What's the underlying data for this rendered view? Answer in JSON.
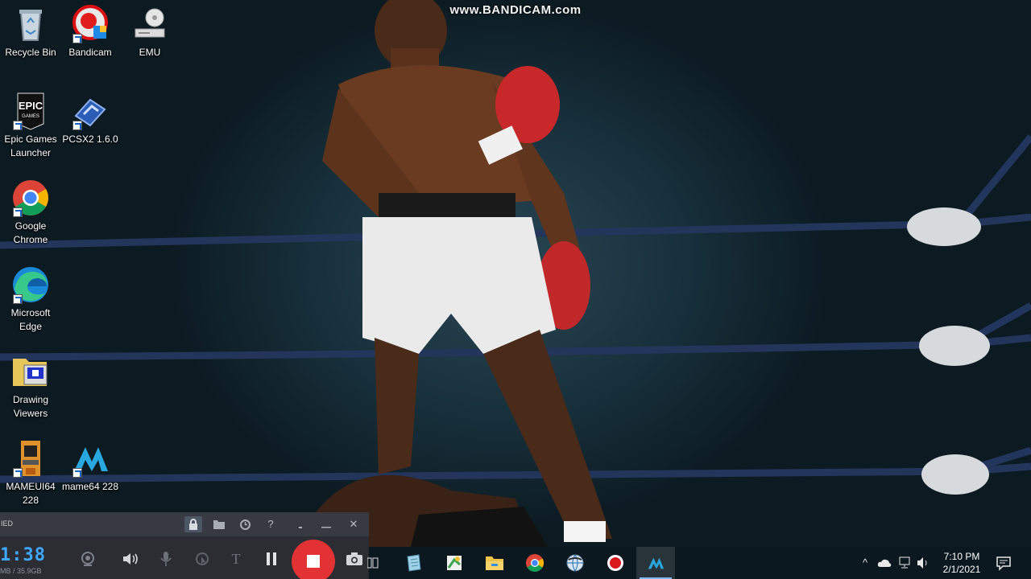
{
  "watermark": "www.BANDICAM.com",
  "desktop_icons": [
    {
      "label": "Recycle Bin",
      "icon": "recycle-bin-icon"
    },
    {
      "label": "Bandicam",
      "icon": "bandicam-icon"
    },
    {
      "label": "EMU",
      "icon": "drive-icon"
    },
    {
      "label": "Epic Games Launcher",
      "icon": "epic-games-icon"
    },
    {
      "label": "PCSX2 1.6.0",
      "icon": "pcsx2-icon"
    },
    {
      "label": "Google Chrome",
      "icon": "chrome-icon"
    },
    {
      "label": "Microsoft Edge",
      "icon": "edge-icon"
    },
    {
      "label": "Drawing Viewers",
      "icon": "folder-icon"
    },
    {
      "label": "MAMEUI64 228",
      "icon": "arcade-cabinet-icon"
    },
    {
      "label": "mame64 228",
      "icon": "mame-icon"
    }
  ],
  "bandicam": {
    "title_fragment": "IED",
    "timer": "1:38",
    "file_size": "MB / 35.9GB",
    "top_buttons": [
      "lock-icon",
      "folder-icon",
      "clock-icon",
      "help-icon",
      "minimize-to-icon",
      "minimize-icon",
      "close-icon"
    ],
    "help_glyph": "?",
    "close_glyph": "✕",
    "text_glyph": "T"
  },
  "taskbar": {
    "apps": [
      {
        "name": "task-view-icon",
        "active": false
      },
      {
        "name": "notepad-icon",
        "active": false
      },
      {
        "name": "sticky-app-icon",
        "active": false
      },
      {
        "name": "file-explorer-icon",
        "active": false
      },
      {
        "name": "chrome-icon",
        "active": false
      },
      {
        "name": "globe-app-icon",
        "active": false
      },
      {
        "name": "bandicam-record-icon",
        "active": false
      },
      {
        "name": "mame-icon",
        "active": true
      }
    ],
    "tray": {
      "chevron": "^",
      "icons": [
        "cloud-icon",
        "network-icon",
        "volume-icon"
      ]
    },
    "clock": {
      "time": "7:10 PM",
      "date": "2/1/2021"
    },
    "colors": {
      "accent": "#7fb8ef",
      "record": "#e23233",
      "timer": "#3fa8ff"
    }
  }
}
